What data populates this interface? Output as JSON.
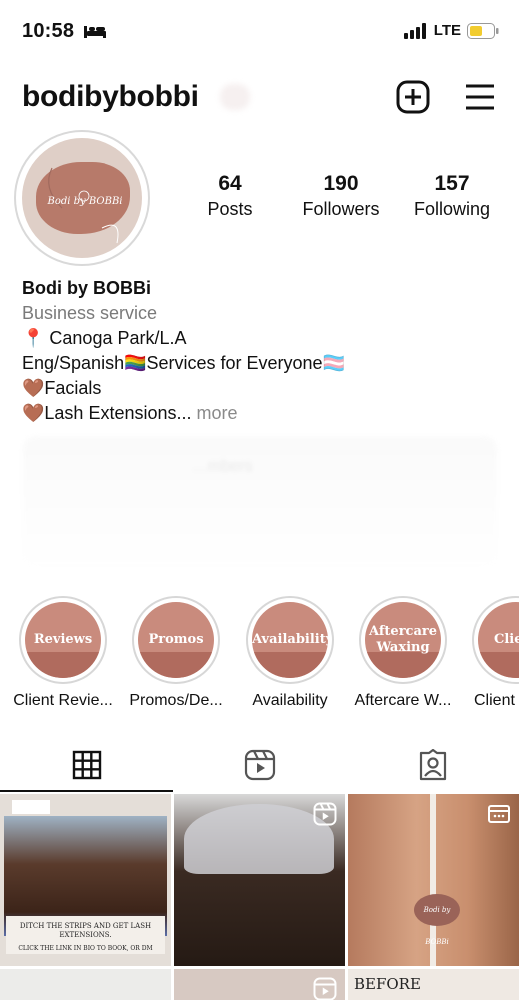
{
  "status_bar": {
    "time": "10:58",
    "carrier": "LTE",
    "sleep_icon": "bed-icon",
    "signal_icon": "signal-bars-icon",
    "battery_icon": "battery-low-icon"
  },
  "header": {
    "username": "bodibybobbi",
    "add_icon": "plus-square-icon",
    "menu_icon": "hamburger-menu-icon"
  },
  "profile": {
    "avatar_text": "Bodi by BOBBi",
    "stats": [
      {
        "value": "64",
        "label": "Posts"
      },
      {
        "value": "190",
        "label": "Followers"
      },
      {
        "value": "157",
        "label": "Following"
      }
    ]
  },
  "bio": {
    "name": "Bodi by BOBBi",
    "category": "Business service",
    "lines": [
      "📍 Canoga Park/L.A",
      "Eng/Spanish🏳️‍🌈Services for Everyone🏳️‍⚧️",
      "🤎Facials",
      "🤎Lash Extensions..."
    ],
    "more": "more"
  },
  "faded_box_text": "…mbers",
  "highlights": [
    {
      "cover": "Reviews",
      "label": "Client Revie..."
    },
    {
      "cover": "Promos",
      "label": "Promos/De..."
    },
    {
      "cover": "Availability",
      "label": "Availability"
    },
    {
      "cover": "Aftercare Waxing",
      "label": "Aftercare W..."
    },
    {
      "cover": "Client",
      "label": "Client"
    }
  ],
  "tabs": [
    {
      "icon": "grid-icon",
      "active": true
    },
    {
      "icon": "reels-icon",
      "active": false
    },
    {
      "icon": "tagged-person-icon",
      "active": false
    }
  ],
  "grid": {
    "post1_caption": "DITCH THE STRIPS AND GET LASH EXTENSIONS.",
    "post1_subcaption": "CLICK THE LINK IN BIO TO BOOK, OR DM",
    "post3_sticker": "Bodi by BOBBi",
    "post6_label": "BEFORE"
  },
  "colors": {
    "brand_rose": "#c98b7d",
    "brand_dark": "#b06b5e",
    "text_gray": "#7a7a7a"
  }
}
